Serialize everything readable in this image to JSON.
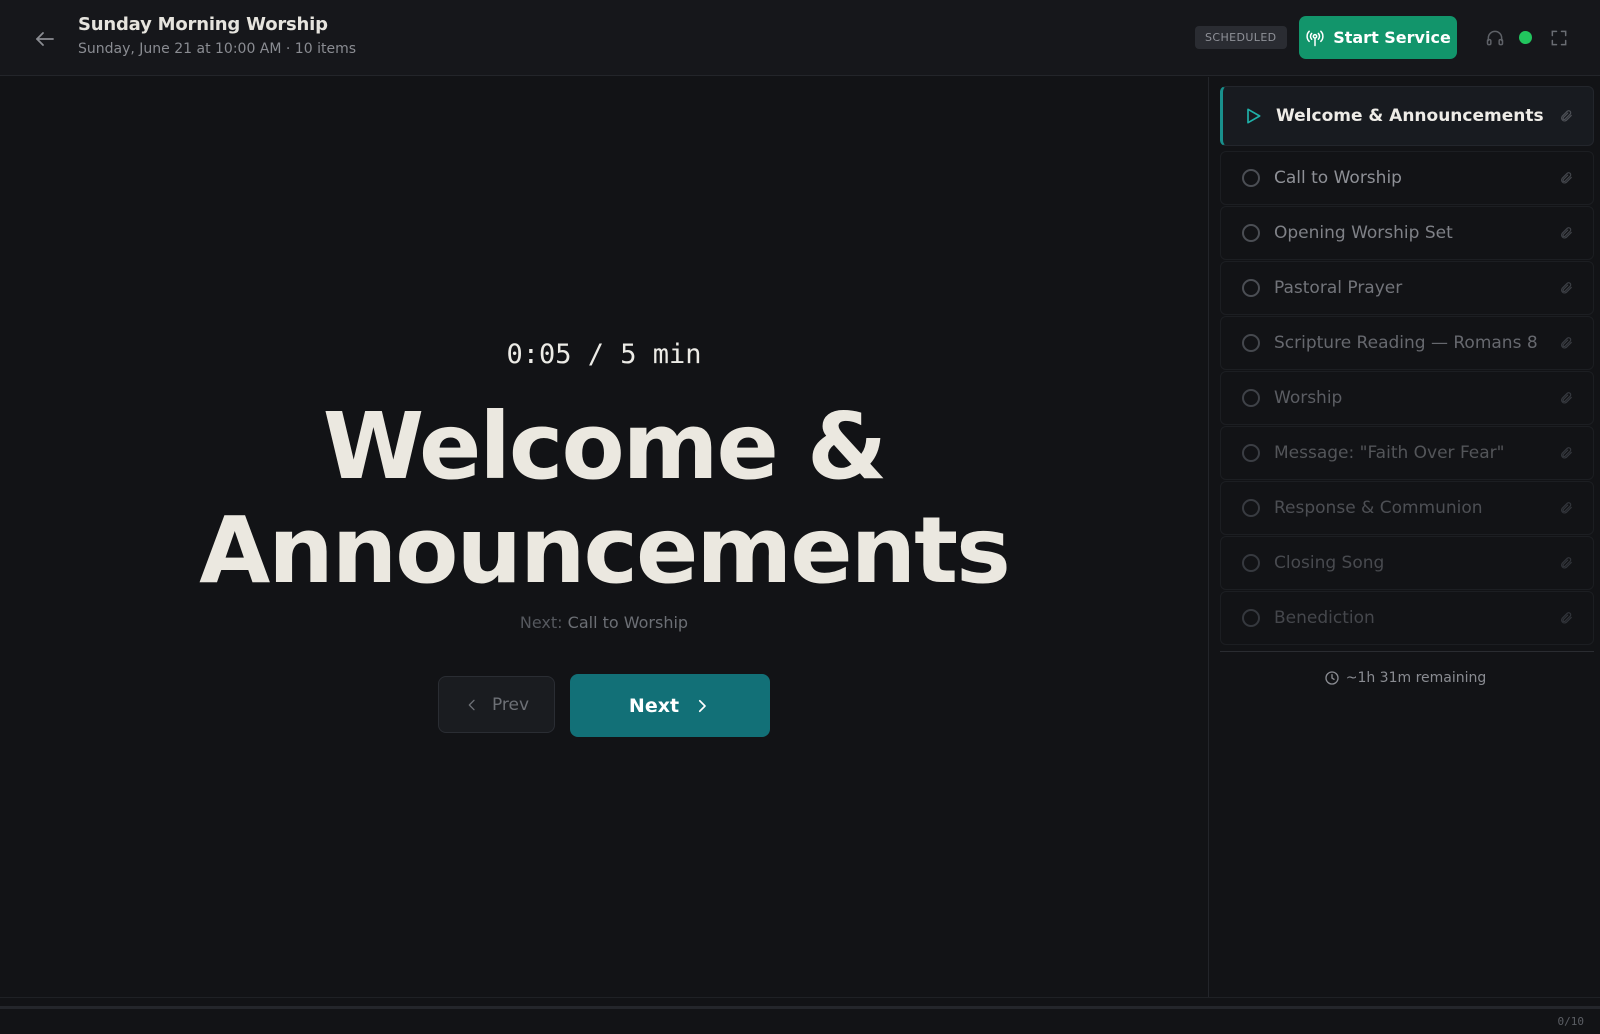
{
  "header": {
    "title": "Sunday Morning Worship",
    "subtitle": "Sunday, June 21 at 10:00 AM · 10 items",
    "badge": "SCHEDULED",
    "start_label": "Start Service"
  },
  "stage": {
    "timer": "0:05 / 5 min",
    "title_line1": "Welcome &",
    "title_line2": "Announcements",
    "next_prefix": "Next:",
    "next_name": "Call to Worship",
    "prev_label": "Prev",
    "next_label": "Next"
  },
  "sidebar": {
    "items": [
      {
        "label": "Welcome & Announcements",
        "state": "current"
      },
      {
        "label": "Call to Worship",
        "state": "pending"
      },
      {
        "label": "Opening Worship Set",
        "state": "pending"
      },
      {
        "label": "Pastoral Prayer",
        "state": "pending"
      },
      {
        "label": "Scripture Reading — Romans 8",
        "state": "pending"
      },
      {
        "label": "Worship",
        "state": "pending"
      },
      {
        "label": "Message: \"Faith Over Fear\"",
        "state": "pending"
      },
      {
        "label": "Response & Communion",
        "state": "pending"
      },
      {
        "label": "Closing Song",
        "state": "pending"
      },
      {
        "label": "Benediction",
        "state": "pending"
      }
    ],
    "remaining": "~1h 31m remaining"
  },
  "footer": {
    "count": "0/10",
    "progress": 0
  },
  "colors": {
    "accent": "#19908c",
    "start_button": "#12956b",
    "live": "#22c55e",
    "next_button": "#127077"
  }
}
